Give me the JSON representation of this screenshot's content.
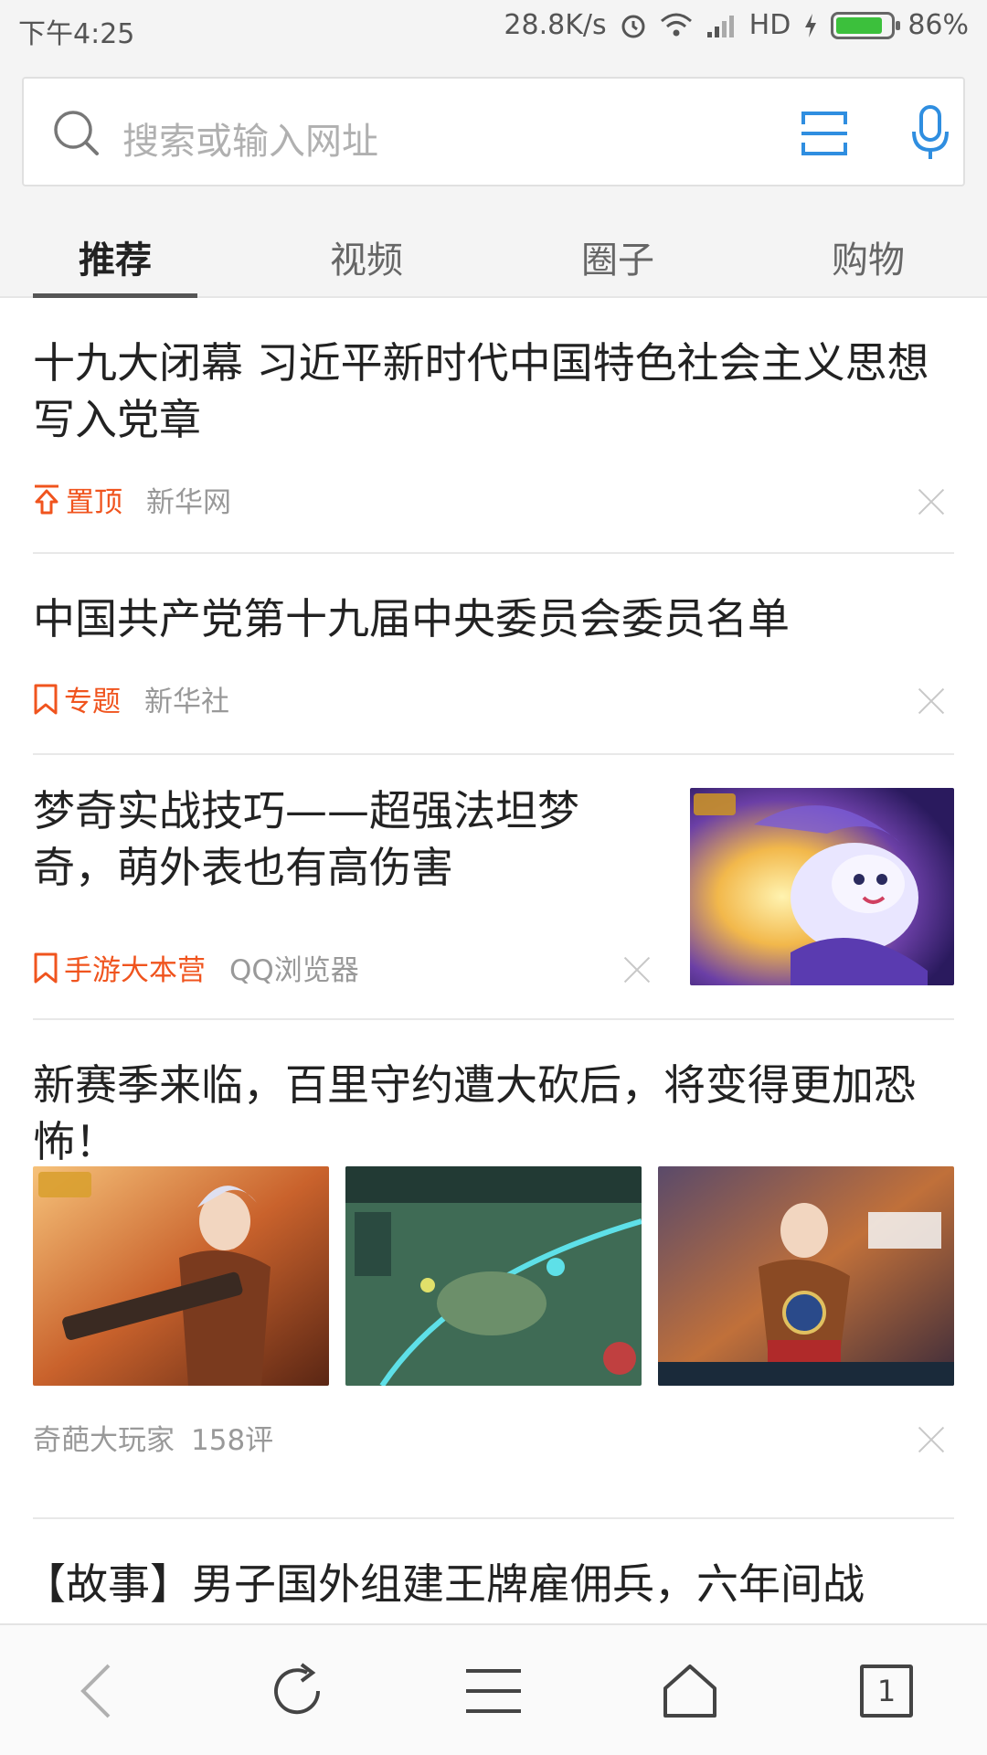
{
  "status_bar": {
    "time": "下午4:25",
    "speed": "28.8K/s",
    "network": "HD",
    "battery": "86%",
    "battery_level": 0.86
  },
  "search": {
    "placeholder": "搜索或输入网址"
  },
  "tabs": [
    {
      "label": "推荐",
      "active": true
    },
    {
      "label": "视频",
      "active": false
    },
    {
      "label": "圈子",
      "active": false
    },
    {
      "label": "购物",
      "active": false
    }
  ],
  "feed": [
    {
      "title": "十九大闭幕 习近平新时代中国特色社会主义思想写入党章",
      "tag": "置顶",
      "tag_icon": "pin-top-icon",
      "source": "新华网"
    },
    {
      "title": "中国共产党第十九届中央委员会委员名单",
      "tag": "专题",
      "tag_icon": "bookmark-icon",
      "source": "新华社"
    },
    {
      "title": "梦奇实战技巧——超强法坦梦奇，萌外表也有高伤害",
      "tag": "手游大本营",
      "tag_icon": "bookmark-icon",
      "source": "QQ浏览器"
    },
    {
      "title": "新赛季来临，百里守约遭大砍后，将变得更加恐怖！",
      "source": "奇葩大玩家",
      "comments": "158评"
    },
    {
      "title": "【故事】男子国外组建王牌雇佣兵，六年间战"
    }
  ],
  "bottom_nav": {
    "tab_count": "1"
  },
  "colors": {
    "accent_orange": "#f0541e",
    "accent_blue": "#2f8ee0"
  }
}
